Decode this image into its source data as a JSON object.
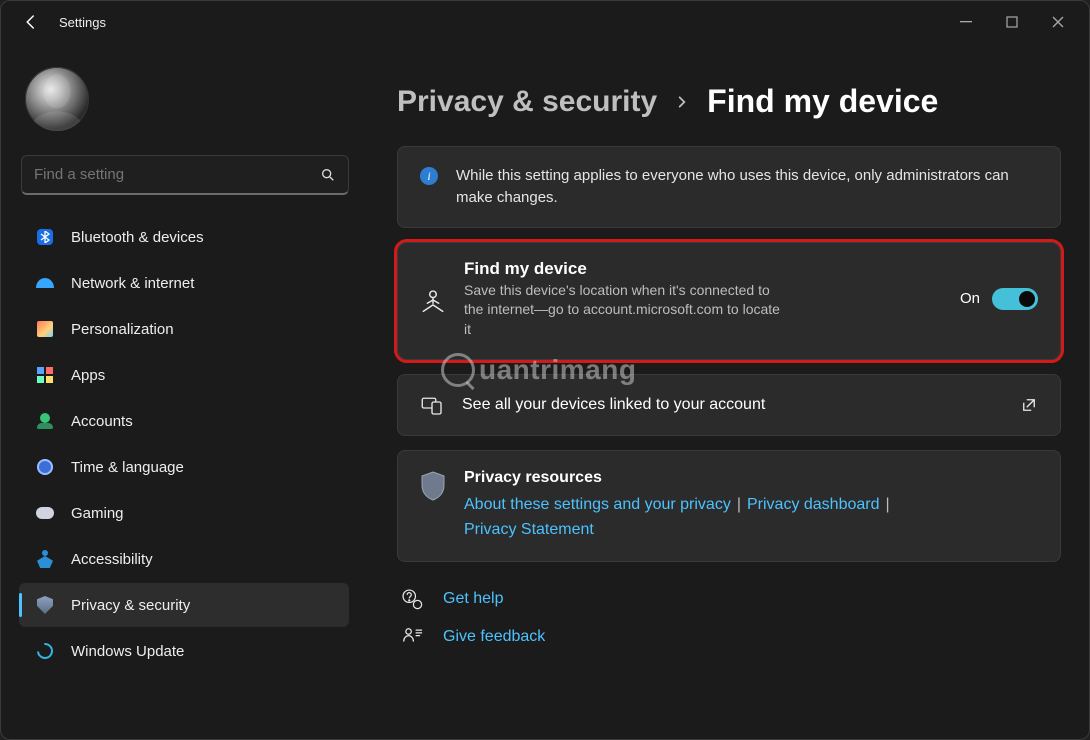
{
  "app_title": "Settings",
  "search": {
    "placeholder": "Find a setting"
  },
  "sidebar": {
    "items": [
      {
        "label": "Bluetooth & devices"
      },
      {
        "label": "Network & internet"
      },
      {
        "label": "Personalization"
      },
      {
        "label": "Apps"
      },
      {
        "label": "Accounts"
      },
      {
        "label": "Time & language"
      },
      {
        "label": "Gaming"
      },
      {
        "label": "Accessibility"
      },
      {
        "label": "Privacy & security"
      },
      {
        "label": "Windows Update"
      }
    ]
  },
  "breadcrumb": {
    "parent": "Privacy & security",
    "current": "Find my device"
  },
  "info_banner": "While this setting applies to everyone who uses this device, only administrators can make changes.",
  "find_my_device": {
    "title": "Find my device",
    "description": "Save this device's location when it's connected to the internet—go to account.microsoft.com to locate it",
    "state_label": "On"
  },
  "linked_devices": {
    "label": "See all your devices linked to your account"
  },
  "privacy_resources": {
    "title": "Privacy resources",
    "links": [
      "About these settings and your privacy",
      "Privacy dashboard",
      "Privacy Statement"
    ]
  },
  "footer": {
    "help": "Get help",
    "feedback": "Give feedback"
  },
  "watermark": "uantrimang"
}
